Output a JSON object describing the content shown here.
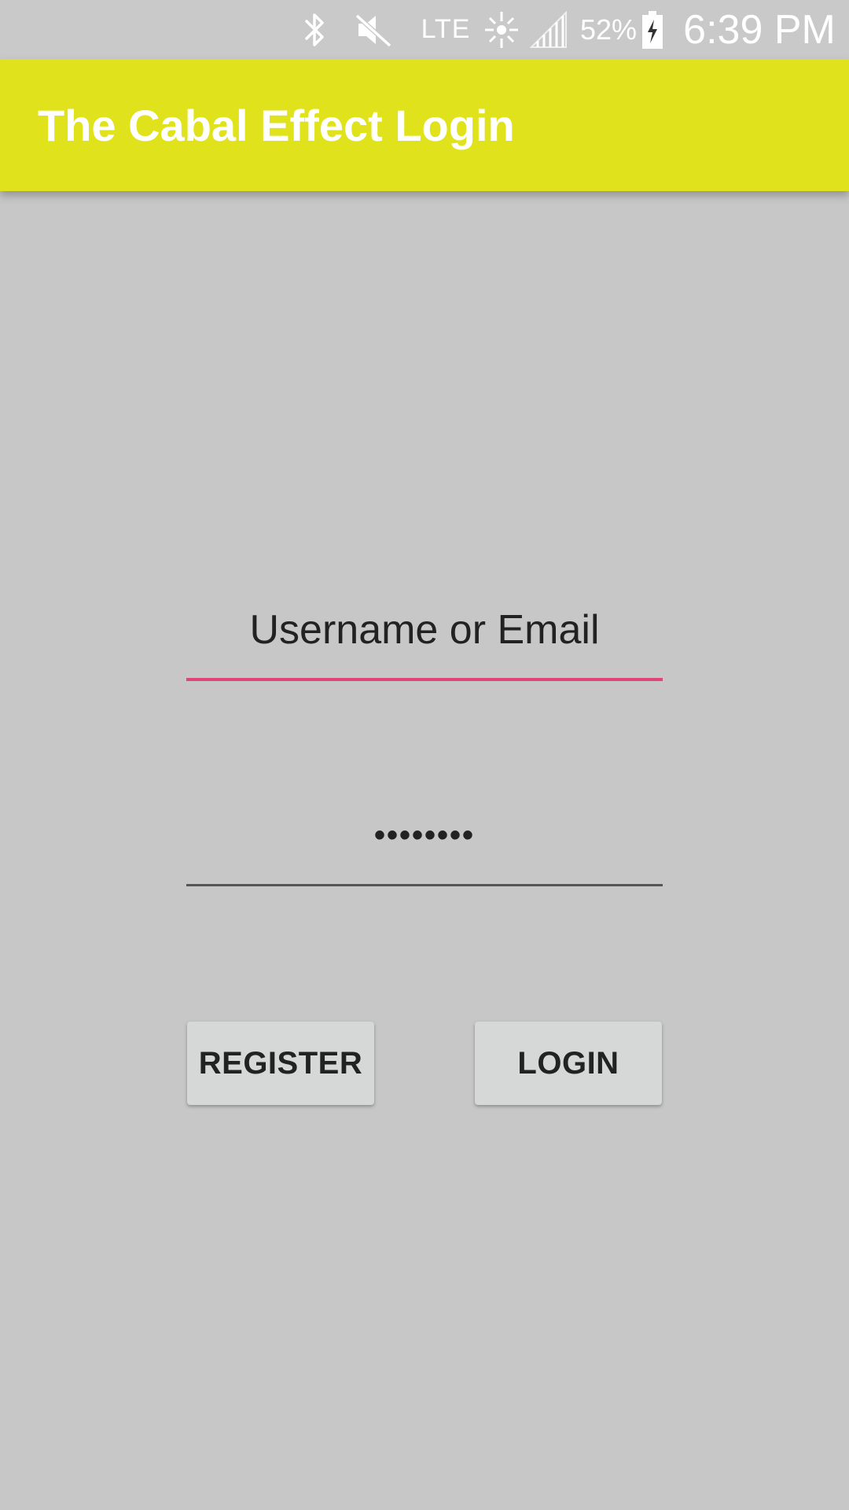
{
  "status_bar": {
    "icons": [
      "bluetooth-icon",
      "mute-icon",
      "sync-icon",
      "signal-icon",
      "battery-charging-icon"
    ],
    "network": "LTE",
    "battery_percent": "52%",
    "time": "6:39 PM"
  },
  "app_bar": {
    "title": "The Cabal Effect Login",
    "color": "#e0e31c"
  },
  "form": {
    "username_value": "Username or Email",
    "password_value": "••••••••",
    "register_label": "REGISTER",
    "login_label": "LOGIN"
  },
  "colors": {
    "background": "#c7c7c7",
    "accent_underline": "#e0457a",
    "button_bg": "#d6d7d7"
  }
}
